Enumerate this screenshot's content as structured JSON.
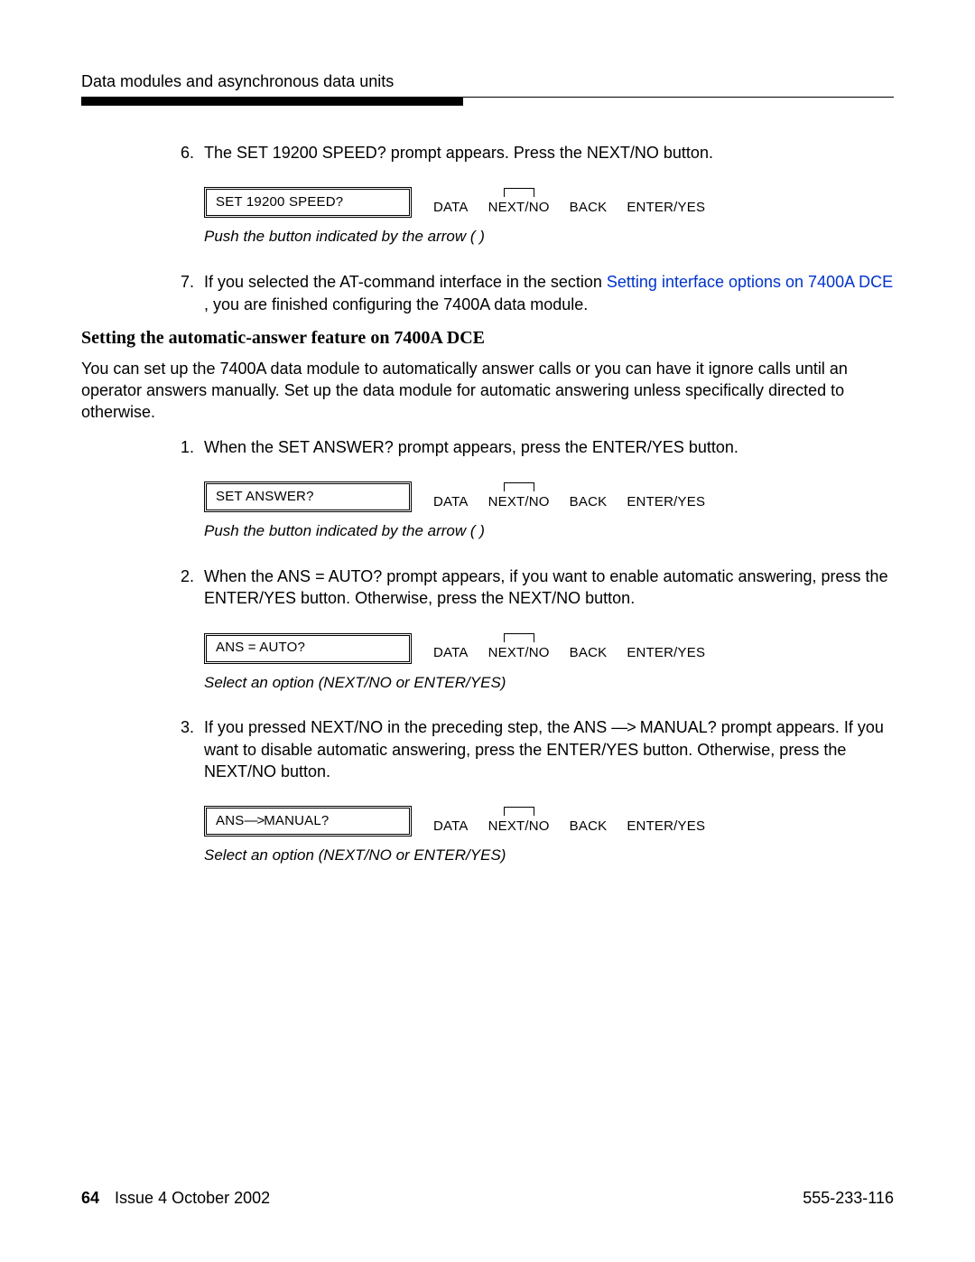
{
  "header": {
    "running_head": "Data modules and asynchronous data units"
  },
  "step6": {
    "number": "6.",
    "text": "The SET 19200 SPEED? prompt appears. Press the NEXT/NO button.",
    "lcd": "SET 19200 SPEED?",
    "buttons": {
      "data": "DATA",
      "next": "NEXT/NO",
      "back": "BACK",
      "enter": "ENTER/YES"
    },
    "caption": "Push the button indicated by the arrow (    )"
  },
  "step7": {
    "number": "7.",
    "pre": "If you selected the AT-command interface in the section ",
    "link": "Setting interface options on 7400A DCE",
    "post": " , you are finished configuring the 7400A data module."
  },
  "section_title": "Setting the automatic-answer feature on 7400A DCE",
  "intro": "You can set up the 7400A data module to automatically answer calls or you can have it ignore calls until an operator answers manually. Set up the data module for automatic answering unless specifically directed to otherwise.",
  "sa_step1": {
    "number": "1.",
    "text": "When the SET ANSWER? prompt appears, press the ENTER/YES button.",
    "lcd": "SET ANSWER?",
    "buttons": {
      "data": "DATA",
      "next": "NEXT/NO",
      "back": "BACK",
      "enter": "ENTER/YES"
    },
    "caption": "Push the button indicated by the arrow (    )"
  },
  "sa_step2": {
    "number": "2.",
    "text": "When the ANS = AUTO? prompt appears, if you want to enable automatic answering, press the ENTER/YES button. Otherwise, press the NEXT/NO button.",
    "lcd": "ANS = AUTO?",
    "buttons": {
      "data": "DATA",
      "next": "NEXT/NO",
      "back": "BACK",
      "enter": "ENTER/YES"
    },
    "caption": "Select an option (NEXT/NO or ENTER/YES)"
  },
  "sa_step3": {
    "number": "3.",
    "text_pre": "If you pressed NEXT/NO in the preceding step, the ANS ",
    "arrow": "—>",
    "text_post": " MANUAL? prompt appears. If you want to disable automatic answering, press the ENTER/YES button. Otherwise, press the NEXT/NO button.",
    "lcd_pre": "ANS ",
    "lcd_arrow": "—>",
    "lcd_post": " MANUAL?",
    "buttons": {
      "data": "DATA",
      "next": "NEXT/NO",
      "back": "BACK",
      "enter": "ENTER/YES"
    },
    "caption": "Select an option (NEXT/NO or ENTER/YES)"
  },
  "footer": {
    "page": "64",
    "issue": "Issue 4   October 2002",
    "docnum": "555-233-116"
  }
}
